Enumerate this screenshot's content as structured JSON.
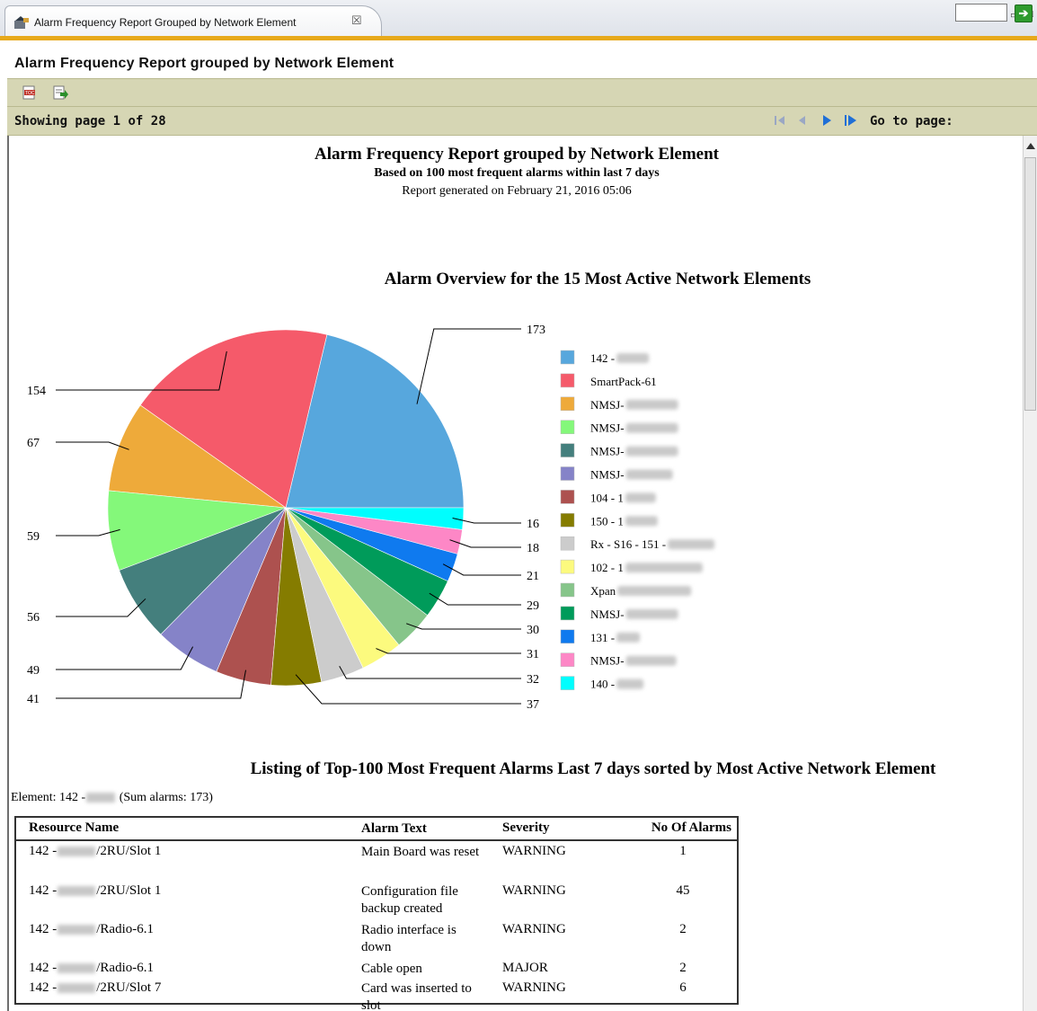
{
  "tab": {
    "label": "Alarm Frequency Report Grouped by Network Element",
    "close": "☒"
  },
  "view_title": "Alarm Frequency Report grouped by Network Element",
  "pager": {
    "showing": "Showing page",
    "current_page": "1",
    "of": "of",
    "total_pages": "28",
    "goto_label": "Go to page:",
    "goto_value": ""
  },
  "report": {
    "title": "Alarm Frequency Report grouped by Network Element",
    "subtitle": "Based on 100 most frequent alarms within last 7 days",
    "generated": "Report generated on February 21, 2016 05:06",
    "chart_title": "Alarm Overview for the 15 Most Active Network Elements",
    "listing_title": "Listing of Top-100 Most Frequent Alarms Last 7 days sorted by Most Active Network Element",
    "element_prefix": "Element: 142 -",
    "element_suffix": "(Sum alarms: 173)"
  },
  "chart_data": {
    "type": "pie",
    "title": "Alarm Overview for the 15 Most Active Network Elements",
    "categories": [
      "142 -",
      "SmartPack-61",
      "NMSJ-",
      "NMSJ-",
      "NMSJ-",
      "NMSJ-",
      "104 - 1",
      "150 - 1",
      "Rx - S16 - 151 -",
      "102 - 1",
      "Xpan",
      "NMSJ-",
      "131 -",
      "NMSJ-",
      "140 -"
    ],
    "values": [
      173,
      154,
      67,
      59,
      56,
      49,
      41,
      37,
      32,
      31,
      30,
      29,
      21,
      18,
      16
    ],
    "colors": [
      "#57a7dd",
      "#f55a6a",
      "#eeaa3a",
      "#84f87a",
      "#447f7d",
      "#8583c8",
      "#ad514f",
      "#857c00",
      "#cccccc",
      "#fcfa7e",
      "#86c58a",
      "#009b5a",
      "#0f7aef",
      "#fd87c6",
      "#00fefe"
    ]
  },
  "table": {
    "headers": [
      "Resource Name",
      "Alarm Text",
      "Severity",
      "No Of Alarms"
    ],
    "rows": [
      {
        "prefix": "142 -",
        "suffix": "/2RU/Slot 1",
        "text": "Main Board was reset",
        "severity": "WARNING",
        "count": "1"
      },
      {
        "prefix": "142 -",
        "suffix": "/2RU/Slot 1",
        "text": "Configuration file backup created",
        "severity": "WARNING",
        "count": "45"
      },
      {
        "prefix": "142 -",
        "suffix": "/Radio-6.1",
        "text": "Radio interface is down",
        "severity": "WARNING",
        "count": "2"
      },
      {
        "prefix": "142 -",
        "suffix": "/Radio-6.1",
        "text": "Cable open",
        "severity": "MAJOR",
        "count": "2"
      },
      {
        "prefix": "142 -",
        "suffix": "/2RU/Slot 7",
        "text": "Card was inserted to slot",
        "severity": "WARNING",
        "count": "6"
      }
    ]
  }
}
